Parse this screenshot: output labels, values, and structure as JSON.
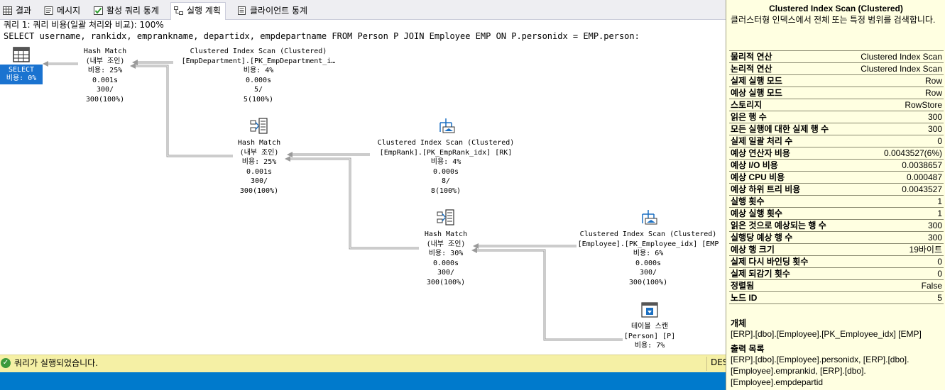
{
  "tabs": [
    {
      "label": "결과",
      "icon": "grid-icon"
    },
    {
      "label": "메시지",
      "icon": "message-icon"
    },
    {
      "label": "활성 쿼리 통계",
      "icon": "active-stats-icon"
    },
    {
      "label": "실행 계획",
      "icon": "execution-plan-icon",
      "active": true
    },
    {
      "label": "클라이언트 통계",
      "icon": "client-stats-icon"
    }
  ],
  "query": {
    "header": "쿼리 1: 쿼리 비용(일괄 처리와 비교): 100%",
    "sql": "SELECT username, rankidx, emprankname, departidx, empdepartname FROM Person P JOIN Employee EMP ON P.personidx = EMP.person:"
  },
  "plan": {
    "select": {
      "label": "SELECT",
      "cost": "비용: 0%"
    },
    "nodes": [
      {
        "id": "hm1",
        "lines": [
          "Hash Match",
          "(내부 조인)",
          "비용: 25%",
          "0.001s",
          "300/",
          "300(100%)"
        ]
      },
      {
        "id": "cis1",
        "lines": [
          "Clustered Index Scan (Clustered)",
          "[EmpDepartment].[PK_EmpDepartment_i…",
          "비용: 4%",
          "0.000s",
          "5/",
          "5(100%)"
        ]
      },
      {
        "id": "hm2",
        "lines": [
          "Hash Match",
          "(내부 조인)",
          "비용: 25%",
          "0.001s",
          "300/",
          "300(100%)"
        ]
      },
      {
        "id": "cis2",
        "lines": [
          "Clustered Index Scan (Clustered)",
          "[EmpRank].[PK_EmpRank_idx] [RK]",
          "비용: 4%",
          "0.000s",
          "8/",
          "8(100%)"
        ]
      },
      {
        "id": "hm3",
        "lines": [
          "Hash Match",
          "(내부 조인)",
          "비용: 30%",
          "0.000s",
          "300/",
          "300(100%)"
        ]
      },
      {
        "id": "cis3",
        "lines": [
          "Clustered Index Scan (Clustered)",
          "[Employee].[PK_Employee_idx] [EMP",
          "비용: 6%",
          "0.000s",
          "300/",
          "300(100%)"
        ]
      },
      {
        "id": "ts",
        "lines": [
          "테이블 스캔",
          "[Person] [P]",
          "비용: 7%"
        ]
      }
    ]
  },
  "status": {
    "text": "쿼리가 실행되었습니다.",
    "right": "DES"
  },
  "tooltip": {
    "title": "Clustered Index Scan (Clustered)",
    "description": "클러스터형 인덱스에서 전체 또는 특정 범위를 검색합니다.",
    "rows": [
      [
        "물리적 연산",
        "Clustered Index Scan"
      ],
      [
        "논리적 연산",
        "Clustered Index Scan"
      ],
      [
        "실제 실행 모드",
        "Row"
      ],
      [
        "예상 실행 모드",
        "Row"
      ],
      [
        "스토리지",
        "RowStore"
      ],
      [
        "읽은 행 수",
        "300"
      ],
      [
        "모든 실행에 대한 실제 행 수",
        "300"
      ],
      [
        "실제 일괄 처리 수",
        "0"
      ],
      [
        "예상 연산자 비용",
        "0.0043527(6%)"
      ],
      [
        "예상 I/O 비용",
        "0.0038657"
      ],
      [
        "예상 CPU 비용",
        "0.000487"
      ],
      [
        "예상 하위 트리 비용",
        "0.0043527"
      ],
      [
        "실행 횟수",
        "1"
      ],
      [
        "예상 실행 횟수",
        "1"
      ],
      [
        "읽은 것으로 예상되는 행 수",
        "300"
      ],
      [
        "실행당 예상 행 수",
        "300"
      ],
      [
        "예상 행 크기",
        "19바이트"
      ],
      [
        "실제 다시 바인딩 횟수",
        "0"
      ],
      [
        "실제 되감기 횟수",
        "0"
      ],
      [
        "정렬됨",
        "False"
      ],
      [
        "노드 ID",
        "5"
      ]
    ],
    "object_heading": "개체",
    "object_value": "[ERP].[dbo].[Employee].[PK_Employee_idx] [EMP]",
    "output_heading": "출력 목록",
    "output_value": "[ERP].[dbo].[Employee].personidx, [ERP].[dbo].[Employee].emprankid, [ERP].[dbo].[Employee].empdepartid"
  }
}
